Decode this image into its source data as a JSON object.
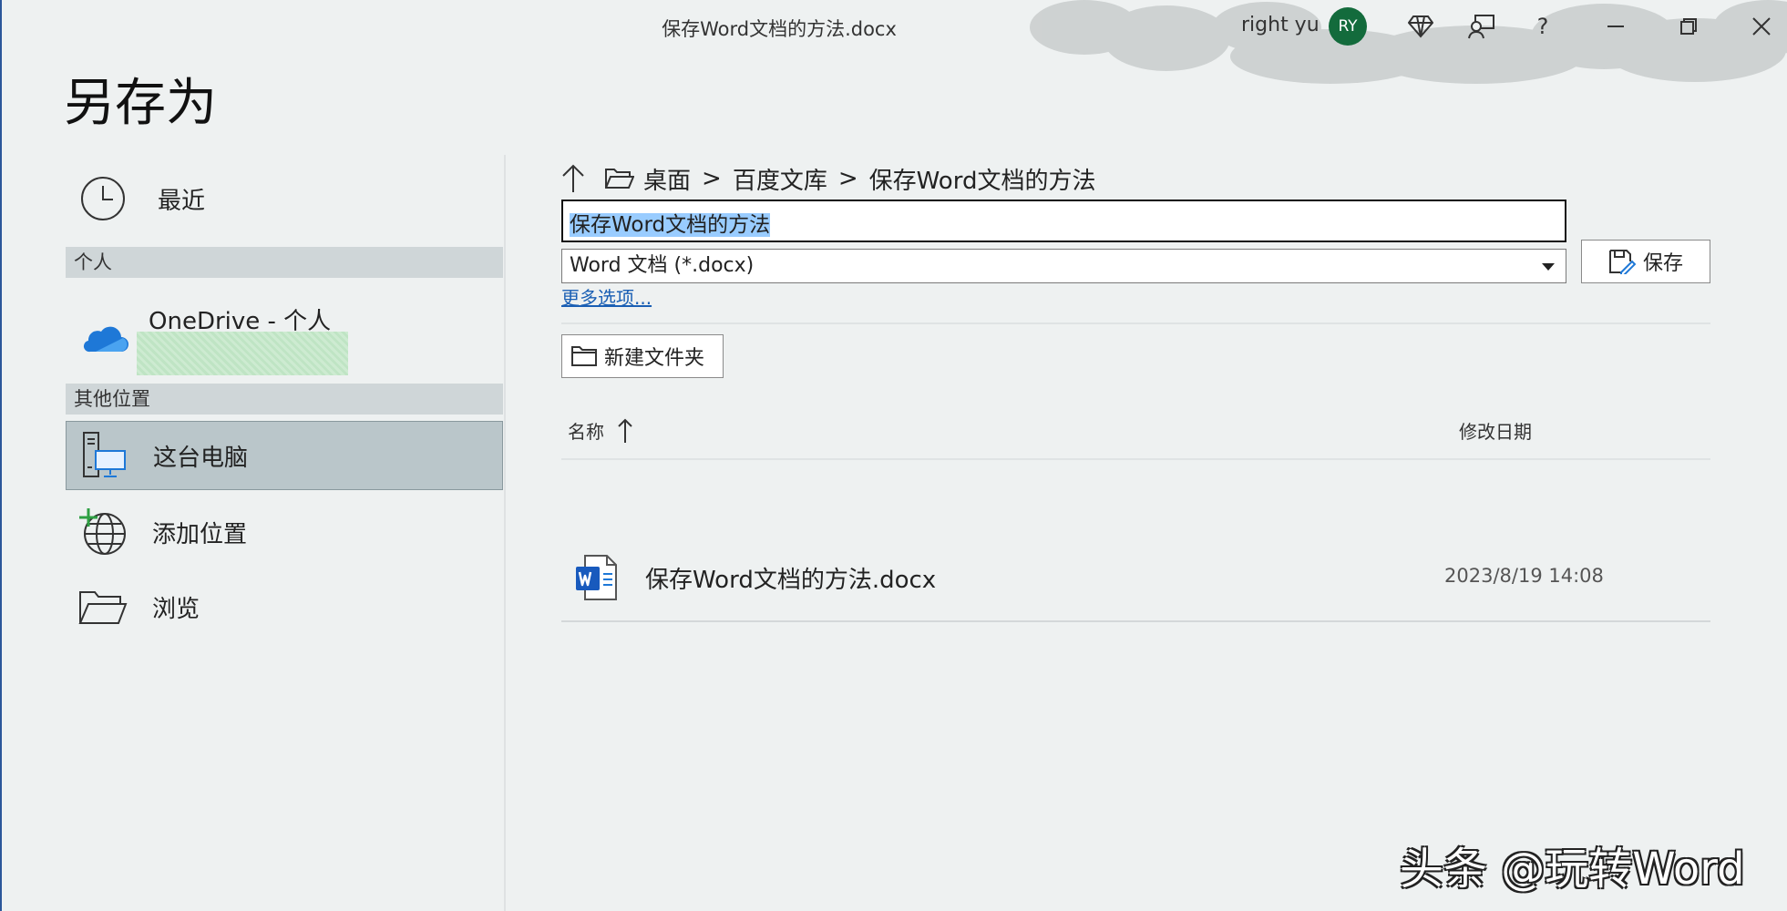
{
  "titlebar": {
    "document_title": "保存Word文档的方法.docx",
    "user_name": "right yu",
    "avatar_initials": "RY",
    "icons": [
      "diamond-icon",
      "coauthor-icon",
      "help-icon",
      "minimize-icon",
      "restore-icon",
      "close-icon"
    ],
    "help_glyph": "?"
  },
  "page": {
    "title": "另存为"
  },
  "nav": {
    "recent_label": "最近",
    "personal_section": "个人",
    "onedrive_label": "OneDrive - 个人",
    "other_section": "其他位置",
    "this_pc_label": "这台电脑",
    "add_place_label": "添加位置",
    "browse_label": "浏览"
  },
  "location": {
    "crumbs": [
      "桌面",
      "百度文库",
      "保存Word文档的方法"
    ],
    "separator": ">"
  },
  "form": {
    "filename": "保存Word文档的方法",
    "filetype": "Word 文档 (*.docx)",
    "save_label": "保存",
    "more_options": "更多选项...",
    "new_folder_label": "新建文件夹"
  },
  "file_list": {
    "col_name": "名称",
    "col_date": "修改日期",
    "sort_icon": "arrow-up-icon",
    "files": [
      {
        "name": "保存Word文档的方法.docx",
        "modified": "2023/8/19 14:08",
        "icon": "word-doc-icon"
      }
    ]
  },
  "watermark": "头条 @玩转Word",
  "colors": {
    "accent": "#2b579a",
    "selected_nav": "#bac6ca",
    "avatar": "#136b3c",
    "link": "#1a5fb4",
    "selection": "#99ccff"
  }
}
